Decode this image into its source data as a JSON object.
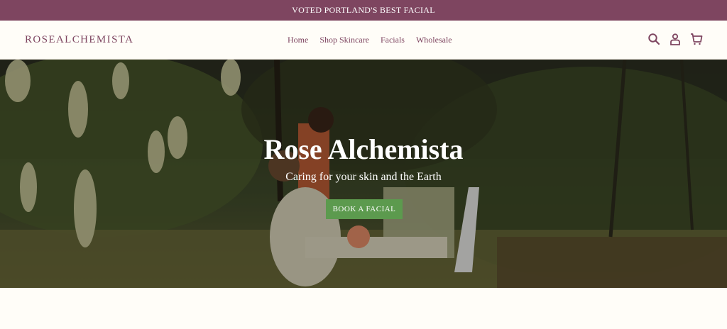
{
  "announcement": {
    "text": "VOTED PORTLAND'S BEST FACIAL"
  },
  "header": {
    "logo": "ROSEALCHEMISTA",
    "nav": [
      {
        "label": "Home"
      },
      {
        "label": "Shop Skincare"
      },
      {
        "label": "Facials"
      },
      {
        "label": "Wholesale"
      }
    ],
    "icons": [
      "search-icon",
      "account-icon",
      "cart-icon"
    ]
  },
  "hero": {
    "title": "Rose Alchemista",
    "subtitle": "Caring for your skin and the Earth",
    "button_label": "BOOK A FACIAL"
  },
  "colors": {
    "brand": "#7e4560",
    "button": "#5c9a4e",
    "background": "#fffdf8"
  }
}
